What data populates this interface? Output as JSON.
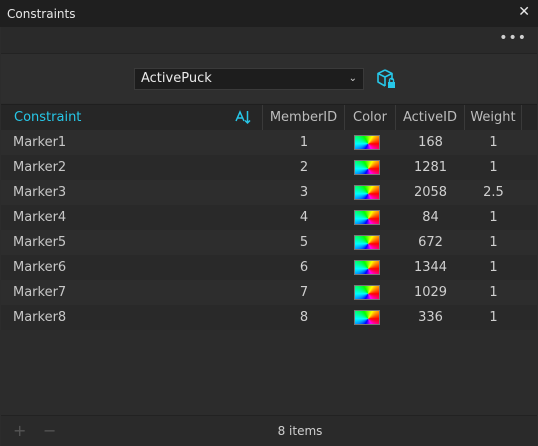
{
  "window": {
    "title": "Constraints",
    "close_glyph": "✕"
  },
  "toolbar": {
    "more_glyph": "•••"
  },
  "selector": {
    "value": "ActivePuck",
    "chevron": "⌄"
  },
  "table": {
    "columns": {
      "constraint": "Constraint",
      "member_id": "MemberID",
      "color": "Color",
      "active_id": "ActiveID",
      "weight": "Weight"
    },
    "rows": [
      {
        "name": "Marker1",
        "member_id": "1",
        "active_id": "168",
        "weight": "1"
      },
      {
        "name": "Marker2",
        "member_id": "2",
        "active_id": "1281",
        "weight": "1"
      },
      {
        "name": "Marker3",
        "member_id": "3",
        "active_id": "2058",
        "weight": "2.5"
      },
      {
        "name": "Marker4",
        "member_id": "4",
        "active_id": "84",
        "weight": "1"
      },
      {
        "name": "Marker5",
        "member_id": "5",
        "active_id": "672",
        "weight": "1"
      },
      {
        "name": "Marker6",
        "member_id": "6",
        "active_id": "1344",
        "weight": "1"
      },
      {
        "name": "Marker7",
        "member_id": "7",
        "active_id": "1029",
        "weight": "1"
      },
      {
        "name": "Marker8",
        "member_id": "8",
        "active_id": "336",
        "weight": "1"
      }
    ]
  },
  "footer": {
    "add_glyph": "+",
    "remove_glyph": "−",
    "count": "8 items"
  },
  "colors": {
    "accent": "#27c7e8",
    "background": "#2c2c2c",
    "titlebar": "#1f1f1f"
  }
}
